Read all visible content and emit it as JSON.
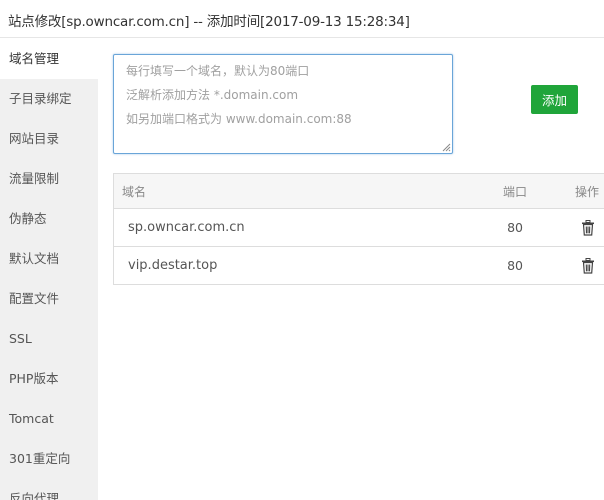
{
  "window": {
    "title": "站点修改[sp.owncar.com.cn] -- 添加时间[2017-09-13 15:28:34]"
  },
  "sidebar": {
    "items": [
      {
        "label": "域名管理",
        "active": true
      },
      {
        "label": "子目录绑定"
      },
      {
        "label": "网站目录"
      },
      {
        "label": "流量限制"
      },
      {
        "label": "伪静态"
      },
      {
        "label": "默认文档"
      },
      {
        "label": "配置文件"
      },
      {
        "label": "SSL"
      },
      {
        "label": "PHP版本"
      },
      {
        "label": "Tomcat"
      },
      {
        "label": "301重定向"
      },
      {
        "label": "反向代理"
      }
    ]
  },
  "domain_form": {
    "placeholder": "每行填写一个域名，默认为80端口\n泛解析添加方法 *.domain.com\n如另加端口格式为 www.domain.com:88",
    "value": "",
    "add_label": "添加"
  },
  "domain_table": {
    "headers": {
      "domain": "域名",
      "port": "端口",
      "action": "操作"
    },
    "rows": [
      {
        "domain": "sp.owncar.com.cn",
        "port": "80",
        "action_icon": "trash-icon"
      },
      {
        "domain": "vip.destar.top",
        "port": "80",
        "action_icon": "trash-icon"
      }
    ]
  },
  "colors": {
    "accent_green": "#20a53a",
    "textarea_focus_border": "#6aa5d8",
    "sidebar_bg": "#f0f0f0",
    "table_header_bg": "#f6f6f6"
  }
}
